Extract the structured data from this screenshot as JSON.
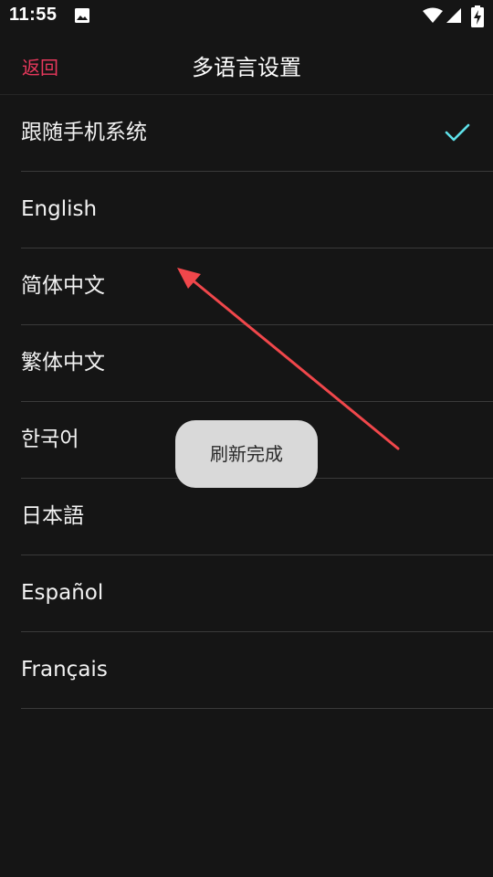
{
  "status_bar": {
    "time": "11:55",
    "icons": [
      "image-icon",
      "wifi-icon",
      "signal-icon",
      "battery-charging-icon"
    ]
  },
  "header": {
    "back_label": "返回",
    "title": "多语言设置"
  },
  "languages": {
    "items": [
      {
        "label": "跟随手机系统",
        "selected": true
      },
      {
        "label": "English",
        "selected": false
      },
      {
        "label": "简体中文",
        "selected": false
      },
      {
        "label": "繁体中文",
        "selected": false
      },
      {
        "label": "한국어",
        "selected": false
      },
      {
        "label": "日本語",
        "selected": false
      },
      {
        "label": "Español",
        "selected": false
      },
      {
        "label": "Français",
        "selected": false
      }
    ]
  },
  "toast": {
    "message": "刷新完成"
  },
  "colors": {
    "background": "#151515",
    "accent_back": "#e8385c",
    "check": "#5ee0e8",
    "annotation_arrow": "#f0474b",
    "toast_bg": "#d9d9d9"
  }
}
